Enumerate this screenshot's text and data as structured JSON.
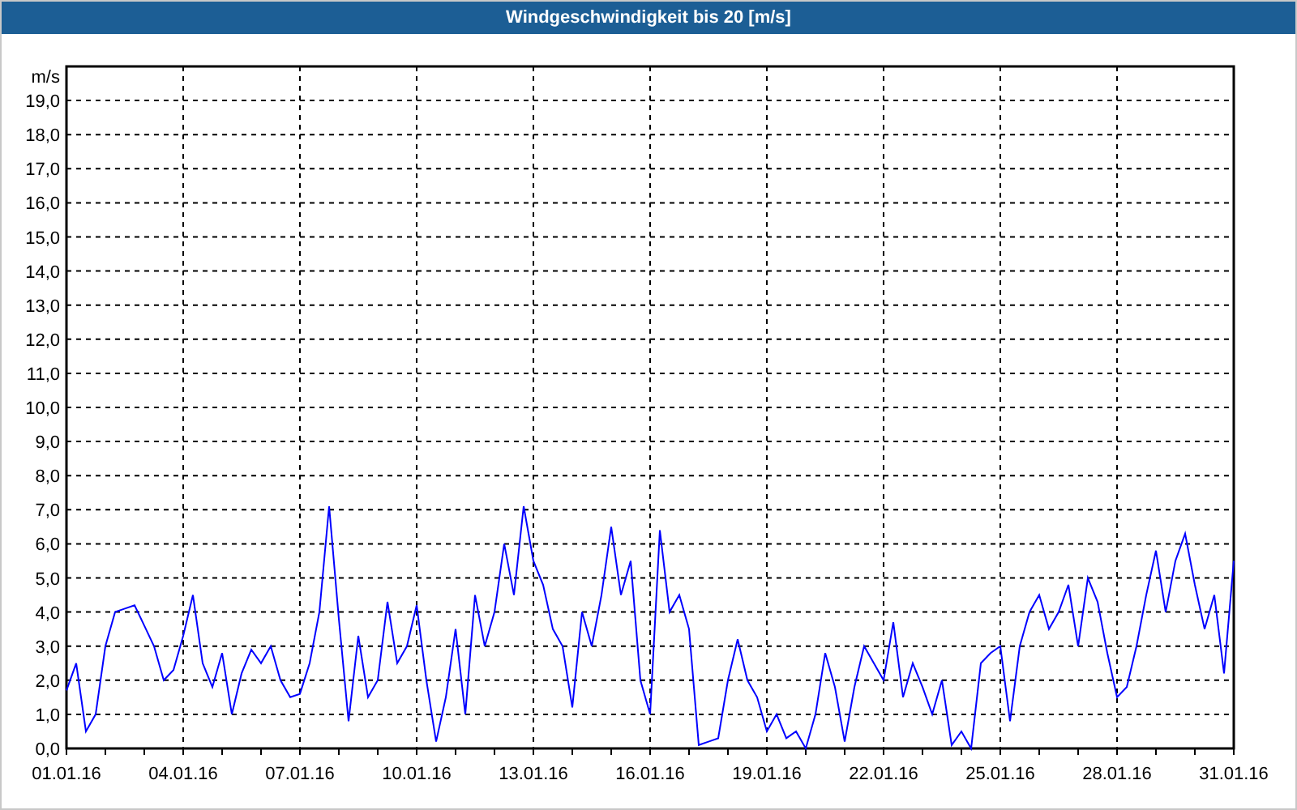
{
  "chart": {
    "chart_data": {
      "type": "line",
      "grid": true,
      "title": "Windgeschwindigkeit bis 20 [m/s]",
      "ylabel": "m/s",
      "ylim": [
        0,
        20
      ],
      "categories": [
        "01.01.16",
        null,
        null,
        null,
        null,
        null,
        null,
        null,
        null,
        null,
        null,
        null,
        "04.01.16",
        null,
        null,
        null,
        null,
        null,
        null,
        null,
        null,
        null,
        null,
        null,
        "07.01.16",
        null,
        null,
        null,
        null,
        null,
        null,
        null,
        null,
        null,
        null,
        null,
        "10.01.16",
        null,
        null,
        null,
        null,
        null,
        null,
        null,
        null,
        null,
        null,
        null,
        "13.01.16",
        null,
        null,
        null,
        null,
        null,
        null,
        null,
        null,
        null,
        null,
        null,
        "16.01.16",
        null,
        null,
        null,
        null,
        null,
        null,
        null,
        null,
        null,
        null,
        null,
        "19.01.16",
        null,
        null,
        null,
        null,
        null,
        null,
        null,
        null,
        null,
        null,
        null,
        "22.01.16",
        null,
        null,
        null,
        null,
        null,
        null,
        null,
        null,
        null,
        null,
        null,
        "25.01.16",
        null,
        null,
        null,
        null,
        null,
        null,
        null,
        null,
        null,
        null,
        null,
        "28.01.16",
        null,
        null,
        null,
        null,
        null,
        null,
        null,
        null,
        null,
        null,
        null,
        "31.01.16"
      ],
      "yticks": [
        {
          "value": 0,
          "label": "0,0"
        },
        {
          "value": 1,
          "label": "1,0"
        },
        {
          "value": 2,
          "label": "2,0"
        },
        {
          "value": 3,
          "label": "3,0"
        },
        {
          "value": 4,
          "label": "4,0"
        },
        {
          "value": 5,
          "label": "5,0"
        },
        {
          "value": 6,
          "label": "6,0"
        },
        {
          "value": 7,
          "label": "7,0"
        },
        {
          "value": 8,
          "label": "8,0"
        },
        {
          "value": 9,
          "label": "9,0"
        },
        {
          "value": 10,
          "label": "10,0"
        },
        {
          "value": 11,
          "label": "11,0"
        },
        {
          "value": 12,
          "label": "12,0"
        },
        {
          "value": 13,
          "label": "13,0"
        },
        {
          "value": 14,
          "label": "14,0"
        },
        {
          "value": 15,
          "label": "15,0"
        },
        {
          "value": 16,
          "label": "16,0"
        },
        {
          "value": 17,
          "label": "17,0"
        },
        {
          "value": 18,
          "label": "18,0"
        },
        {
          "value": 19,
          "label": "19,0"
        }
      ],
      "series": [
        {
          "color": "#0000ff",
          "values": [
            1.7,
            2.5,
            0.5,
            1.0,
            3.0,
            4.0,
            4.1,
            4.2,
            3.6,
            3.0,
            2.0,
            2.3,
            3.3,
            4.5,
            2.5,
            1.8,
            2.8,
            1.0,
            2.2,
            2.9,
            2.5,
            3.0,
            2.0,
            1.5,
            1.6,
            2.5,
            4.0,
            7.1,
            3.8,
            0.8,
            3.3,
            1.5,
            2.0,
            4.3,
            2.5,
            3.0,
            4.2,
            2.0,
            0.2,
            1.5,
            3.5,
            1.0,
            4.5,
            3.0,
            4.0,
            6.0,
            4.5,
            7.1,
            5.5,
            4.8,
            3.5,
            3.0,
            1.2,
            4.0,
            3.0,
            4.5,
            6.5,
            4.5,
            5.5,
            2.0,
            1.0,
            6.4,
            4.0,
            4.5,
            3.5,
            0.1,
            0.2,
            0.3,
            2.0,
            3.2,
            2.0,
            1.5,
            0.5,
            1.0,
            0.3,
            0.5,
            0.0,
            1.0,
            2.8,
            1.8,
            0.2,
            1.8,
            3.0,
            2.5,
            2.0,
            3.7,
            1.5,
            2.5,
            1.8,
            1.0,
            2.0,
            0.1,
            0.5,
            0.0,
            2.5,
            2.8,
            3.0,
            0.8,
            3.0,
            4.0,
            4.5,
            3.5,
            4.0,
            4.8,
            3.0,
            5.0,
            4.3,
            2.8,
            1.5,
            1.8,
            3.0,
            4.5,
            5.8,
            4.0,
            5.5,
            6.3,
            4.8,
            3.5,
            4.5,
            2.2,
            5.5
          ]
        }
      ]
    }
  }
}
